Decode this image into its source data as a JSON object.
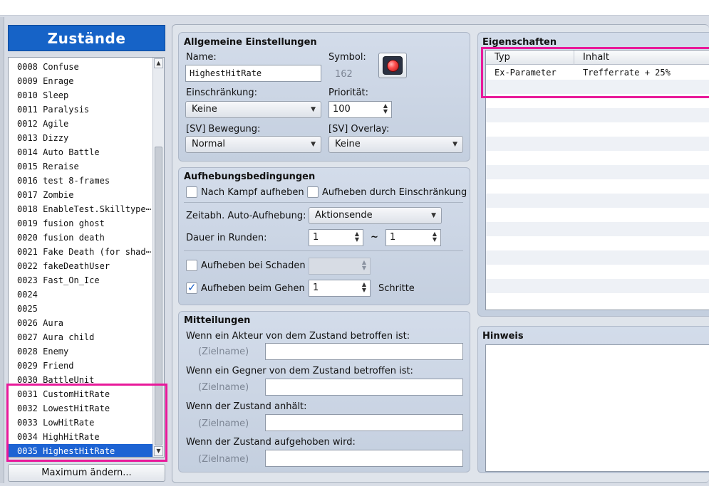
{
  "states": {
    "title": "Zustände",
    "items": [
      "0008 Confuse",
      "0009 Enrage",
      "0010 Sleep",
      "0011 Paralysis",
      "0012 Agile",
      "0013 Dizzy",
      "0014 Auto Battle",
      "0015 Reraise",
      "0016 test 8-frames",
      "0017 Zombie",
      "0018 EnableTest.Skilltype⋯",
      "0019 fusion ghost",
      "0020 fusion death",
      "0021 Fake Death (for shad⋯",
      "0022 fakeDeathUser",
      "0023 Fast_On_Ice",
      "0024",
      "0025",
      "0026 Aura",
      "0027 Aura child",
      "0028 Enemy",
      "0029 Friend",
      "0030 BattleUnit",
      "0031 CustomHitRate",
      "0032 LowestHitRate",
      "0033 LowHitRate",
      "0034 HighHitRate",
      "0035 HighestHitRate"
    ],
    "selected_index": 27,
    "max_button": "Maximum ändern..."
  },
  "general": {
    "title": "Allgemeine Einstellungen",
    "name_label": "Name:",
    "name_value": "HighestHitRate",
    "symbol_label": "Symbol:",
    "symbol_value": "162",
    "restriction_label": "Einschränkung:",
    "restriction_value": "Keine",
    "priority_label": "Priorität:",
    "priority_value": "100",
    "sv_motion_label": "[SV] Bewegung:",
    "sv_motion_value": "Normal",
    "sv_overlay_label": "[SV] Overlay:",
    "sv_overlay_value": "Keine"
  },
  "removal": {
    "title": "Aufhebungsbedingungen",
    "remove_battle_end": "Nach Kampf aufheben",
    "remove_by_restriction": "Aufheben durch Einschränkung",
    "auto_removal_label": "Zeitabh. Auto-Aufhebung:",
    "auto_removal_value": "Aktionsende",
    "duration_label": "Dauer in Runden:",
    "duration_min": "1",
    "duration_sep": "~",
    "duration_max": "1",
    "remove_by_damage": "Aufheben bei Schaden",
    "damage_value": "",
    "remove_by_walking": "Aufheben beim Gehen",
    "walking_value": "1",
    "steps_label": "Schritte",
    "remove_battle_end_checked": false,
    "remove_by_restriction_checked": false,
    "remove_by_damage_checked": false,
    "remove_by_walking_checked": true
  },
  "messages": {
    "title": "Mitteilungen",
    "actor_label": "Wenn ein Akteur von dem Zustand betroffen ist:",
    "enemy_label": "Wenn ein Gegner von dem Zustand betroffen ist:",
    "persist_label": "Wenn der Zustand anhält:",
    "removed_label": "Wenn der Zustand aufgehoben wird:",
    "target_name": "(Zielname)"
  },
  "traits": {
    "title": "Eigenschaften",
    "col_type": "Typ",
    "col_content": "Inhalt",
    "rows": [
      {
        "type": "Ex-Parameter",
        "content": "Trefferrate + 25%"
      }
    ]
  },
  "note": {
    "title": "Hinweis"
  },
  "colors": {
    "selection": "#1d63d3",
    "highlight": "#e8199a",
    "title_blue": "#1663c7"
  }
}
